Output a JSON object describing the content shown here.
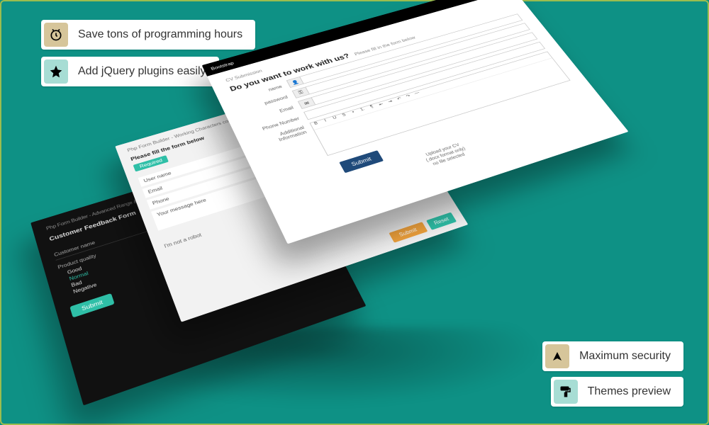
{
  "callouts": {
    "topA": "Save tons of programming hours",
    "topB": "Add jQuery plugins easily",
    "botA": "Maximum security",
    "botB": "Themes preview"
  },
  "darkForm": {
    "header": "Php Form Builder - Advanced Range & Select Feedback Form",
    "title": "Customer Feedback Form",
    "group1": "Customer name",
    "group2": "Product quality",
    "options": [
      "Good",
      "Normal",
      "Bad",
      "Negative"
    ],
    "selected": "Normal",
    "submit": "Submit"
  },
  "lightForm1": {
    "header": "Php Form Builder - Working Characters count Form",
    "title": "Please fill the form below",
    "badgeText": "Required",
    "fields": [
      "User name",
      "Email",
      "Phone",
      "Your message here"
    ],
    "recaptcha": "I'm not a robot",
    "submitPrimary": "Submit",
    "submitCancel": "Reset"
  },
  "lightForm2": {
    "brand": "Bootstrap",
    "squares": [
      "#e74c3c",
      "#2fbfa7",
      "#f0a23c",
      "#2c5aa0"
    ],
    "crumb": "CV Submission",
    "heading": "Do you want to work with us?",
    "subtitle": "Please fill in the form below",
    "rows": [
      {
        "label": "name",
        "prefixIcon": "user"
      },
      {
        "label": "password",
        "prefixIcon": "pass"
      },
      {
        "label": "Email",
        "prefixIcon": "mail"
      },
      {
        "label": "Phone Number",
        "prefixIcon": ""
      },
      {
        "label": "Additional Information",
        "prefixIcon": ""
      }
    ],
    "toolbarIcons": [
      "B",
      "I",
      "U",
      "S",
      "•",
      "1.",
      "¶",
      "⇤",
      "⇥",
      "↶",
      "↷",
      "—"
    ],
    "submit": "Submit",
    "footer": [
      "Upload your CV",
      "(.docx format only)",
      "no file selected"
    ]
  }
}
